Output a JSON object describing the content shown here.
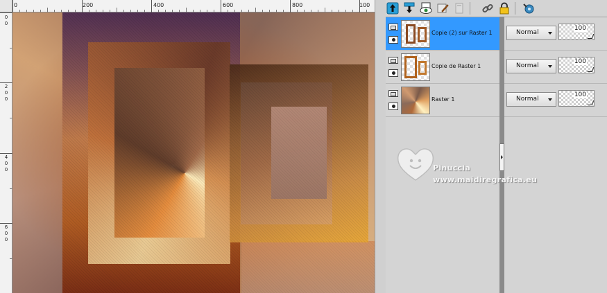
{
  "ruler": {
    "top_labels": [
      "0",
      "200",
      "400",
      "600",
      "800",
      "100"
    ],
    "left_labels": [
      [
        "0",
        "0"
      ],
      [
        "2",
        "0",
        "0"
      ],
      [
        "4",
        "0",
        "0"
      ],
      [
        "6",
        "0",
        "0"
      ]
    ]
  },
  "toolbar": {
    "icons": [
      "new-layer-icon",
      "merge-down-icon",
      "visibility-icon",
      "edit-mask-icon",
      "delete-layer-icon",
      "link-icon",
      "lock-icon",
      "properties-icon"
    ]
  },
  "layers": [
    {
      "name": "Copie (2) sur Raster 1",
      "blend": "Normal",
      "opacity": "100",
      "selected": true
    },
    {
      "name": "Copie de Raster 1",
      "blend": "Normal",
      "opacity": "100",
      "selected": false
    },
    {
      "name": "Raster 1",
      "blend": "Normal",
      "opacity": "100",
      "selected": false
    }
  ],
  "watermark": {
    "name": "Pinuccia",
    "url": "www.maidiregrafica.eu"
  },
  "colors": {
    "selection": "#3399ff",
    "panel_bg": "#d4d4d4"
  }
}
